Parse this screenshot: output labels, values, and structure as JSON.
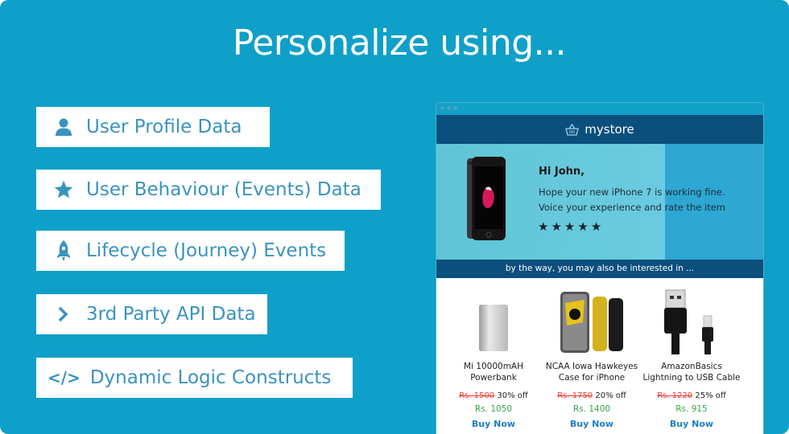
{
  "slide": {
    "title": "Personalize using...",
    "background_color": "#0ea0c8",
    "features": [
      {
        "icon": "user-icon",
        "label": "User Profile Data"
      },
      {
        "icon": "star-icon",
        "label": "User Behaviour (Events) Data"
      },
      {
        "icon": "rocket-icon",
        "label": "Lifecycle (Journey) Events"
      },
      {
        "icon": "chevron-right-icon",
        "label": "3rd Party API Data"
      },
      {
        "icon": "code-icon",
        "label": "Dynamic Logic Constructs",
        "glyph": "</>"
      }
    ]
  },
  "email": {
    "store_name": "mystore",
    "greeting": "Hi John,",
    "message_line1": "Hope your new iPhone 7 is working fine.",
    "message_line2": "Voice your experience and rate the item",
    "rating_stars": 5,
    "cross_sell_banner": "by the way, you may also be interested in ...",
    "header_color": "#0b4f7d",
    "products": [
      {
        "name_line1": "Mi 10000mAH",
        "name_line2": "Powerbank",
        "old_price": "Rs. 1500",
        "discount": "30% off",
        "new_price": "Rs. 1050",
        "cta": "Buy Now"
      },
      {
        "name_line1": "NCAA Iowa Hawkeyes",
        "name_line2": "Case for iPhone",
        "old_price": "Rs. 1750",
        "discount": "20% off",
        "new_price": "Rs. 1400",
        "cta": "Buy Now"
      },
      {
        "name_line1": "AmazonBasics",
        "name_line2": "Lightning to USB Cable",
        "old_price": "Rs. 1220",
        "discount": "25% off",
        "new_price": "Rs. 915",
        "cta": "Buy Now"
      }
    ],
    "colors": {
      "old_price": "#e53935",
      "new_price": "#3aa54a",
      "cta": "#1e7fc2"
    }
  }
}
